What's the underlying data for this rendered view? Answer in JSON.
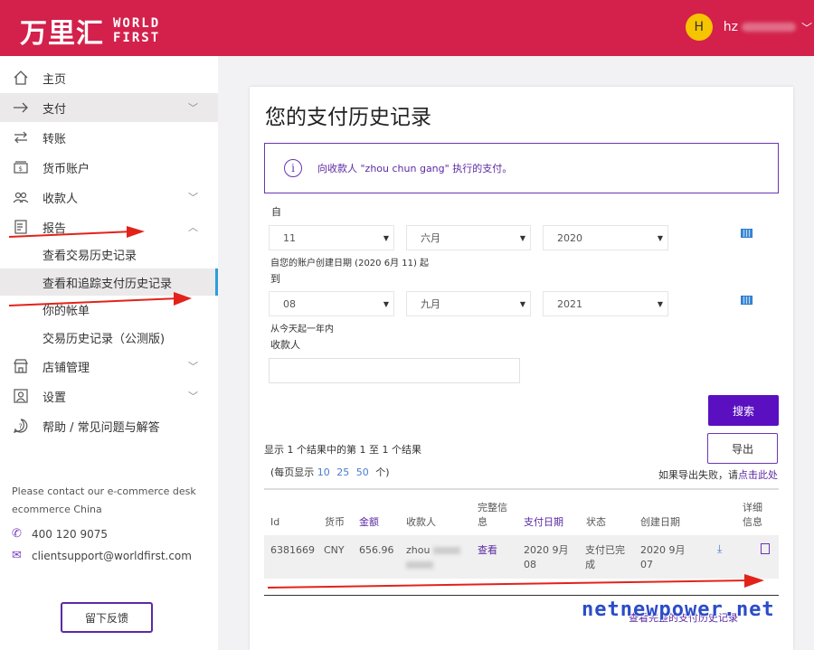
{
  "header": {
    "logo_cn": "万里汇",
    "logo_en_line1": "WORLD",
    "logo_en_line2": "FIRST",
    "avatar_letter": "H",
    "user_name": "hz",
    "brand_color": "#d3214b"
  },
  "sidebar": {
    "items": [
      {
        "label": "主页",
        "icon": "home-icon"
      },
      {
        "label": "支付",
        "icon": "arrow-right-icon"
      },
      {
        "label": "转账",
        "icon": "transfer-icon"
      },
      {
        "label": "货币账户",
        "icon": "wallet-icon"
      },
      {
        "label": "收款人",
        "icon": "people-icon"
      },
      {
        "label": "报告",
        "icon": "report-icon"
      },
      {
        "label": "店铺管理",
        "icon": "store-icon"
      },
      {
        "label": "设置",
        "icon": "settings-icon"
      },
      {
        "label": "帮助 / 常见问题与解答",
        "icon": "help-icon"
      }
    ],
    "sub_items": [
      {
        "label": "查看交易历史记录"
      },
      {
        "label": "查看和追踪支付历史记录"
      },
      {
        "label": "你的帐单"
      },
      {
        "label": "交易历史记录（公测版)"
      }
    ],
    "contact_text": "Please contact our e-commerce desk ecommerce China",
    "phone": "400 120 9075",
    "email": "clientsupport@worldfirst.com",
    "feedback_label": "留下反馈"
  },
  "main": {
    "title": "您的支付历史记录",
    "info_text": "向收款人 \"zhou chun gang\" 执行的支付。",
    "from_label": "自",
    "from_day": "11",
    "from_month": "六月",
    "from_year": "2020",
    "from_hint": "自您的账户创建日期 (2020 6月 11) 起",
    "to_label": "到",
    "to_day": "08",
    "to_month": "九月",
    "to_year": "2021",
    "to_hint": "从今天起一年内",
    "payee_label": "收款人",
    "payee_value": "",
    "search_label": "搜索",
    "export_label": "导出",
    "results_text": "显示 1 个结果中的第 1 至 1 个结果",
    "perpage_prefix": "(每页显示",
    "perpage_options": [
      "10",
      "25",
      "50"
    ],
    "perpage_suffix": "个)",
    "export_fail_text": "如果导出失败，请",
    "export_fail_link": "点击此处",
    "accent_color": "#5a10c0",
    "table": {
      "headers": {
        "id": "Id",
        "currency": "货币",
        "amount": "金额",
        "payee": "收款人",
        "full_info_1": "完整信",
        "full_info_2": "息",
        "pay_date": "支付日期",
        "status": "状态",
        "created": "创建日期",
        "detail_1": "详细",
        "detail_2": "信息"
      },
      "rows": [
        {
          "id": "6381669",
          "currency": "CNY",
          "amount": "656.96",
          "payee": "zhou",
          "full_info": "查看",
          "pay_date_1": "2020 9月",
          "pay_date_2": "08",
          "status_1": "支付已完",
          "status_2": "成",
          "created_1": "2020 9月",
          "created_2": "07"
        }
      ]
    },
    "view_all_label": "查看完整的支付历史记录"
  },
  "watermark": "netnewpower.net"
}
